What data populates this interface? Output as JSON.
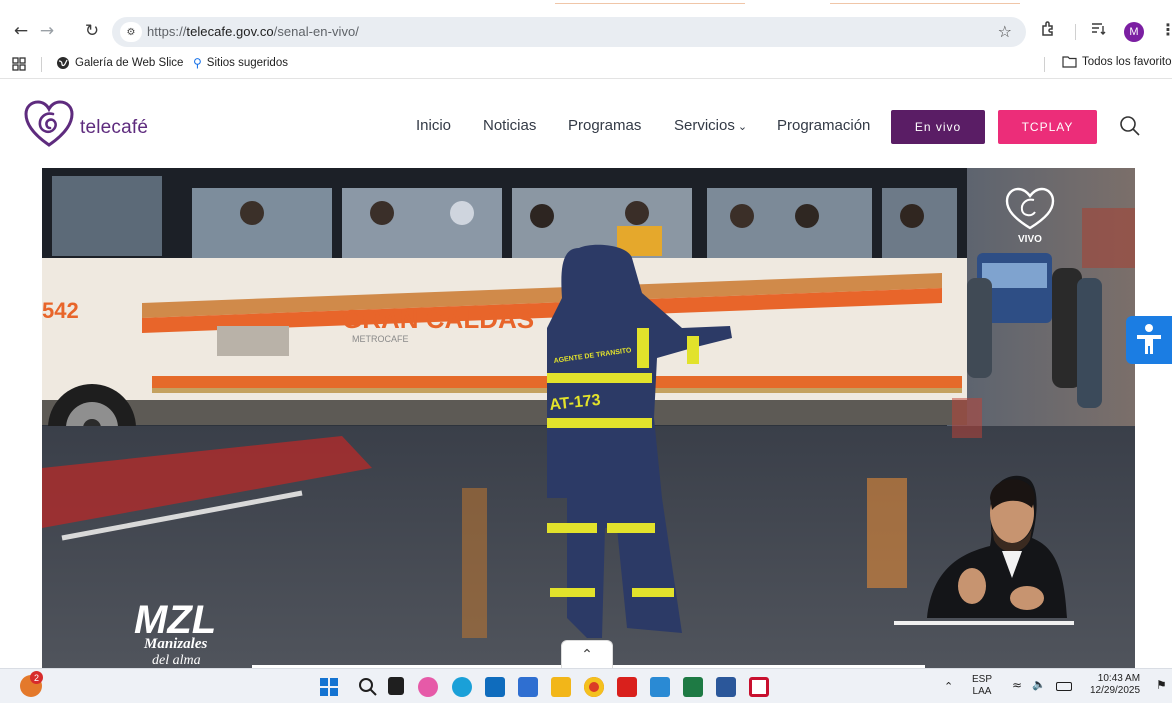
{
  "browser": {
    "nav": {
      "back_icon": "arrow-left-icon",
      "forward_icon": "arrow-right-icon",
      "reload_icon": "reload-icon"
    },
    "address_bar": {
      "scheme": "https://",
      "domain": "telecafe.gov.co",
      "path": "/senal-en-vivo/"
    },
    "bookmarks": {
      "items": [
        {
          "label": "Galería de Web Slice"
        },
        {
          "label": "Sitios sugeridos"
        }
      ],
      "all_favorites": "Todos los favoritos"
    },
    "profile_initial": "M"
  },
  "site": {
    "logo_text": "telecafé",
    "nav": [
      {
        "label": "Inicio"
      },
      {
        "label": "Noticias"
      },
      {
        "label": "Programas"
      },
      {
        "label": "Servicios"
      },
      {
        "label": "Programación"
      }
    ],
    "en_vivo_label": "En vivo",
    "tcplay_label": "TCPLAY",
    "colors": {
      "brand_purple": "#5a1d65",
      "tcplay_pink": "#ec2d79",
      "accessibility_blue": "#1b7de3"
    }
  },
  "video": {
    "bus_text": "GRAN CALDAS",
    "bus_subtext": "METROCAFE",
    "bus_number": "542",
    "jacket_id": "AT-173",
    "jacket_chest": "AGENTE DE TRANSITO",
    "live_bug": "VIVO",
    "brand_overlay": {
      "line1": "MZL",
      "line2": "Manizales",
      "line3": "del alma"
    }
  },
  "taskbar": {
    "notification_count": "2",
    "language": {
      "line1": "ESP",
      "line2": "LAA"
    },
    "time": "10:43 AM",
    "date": "12/29/2025"
  }
}
